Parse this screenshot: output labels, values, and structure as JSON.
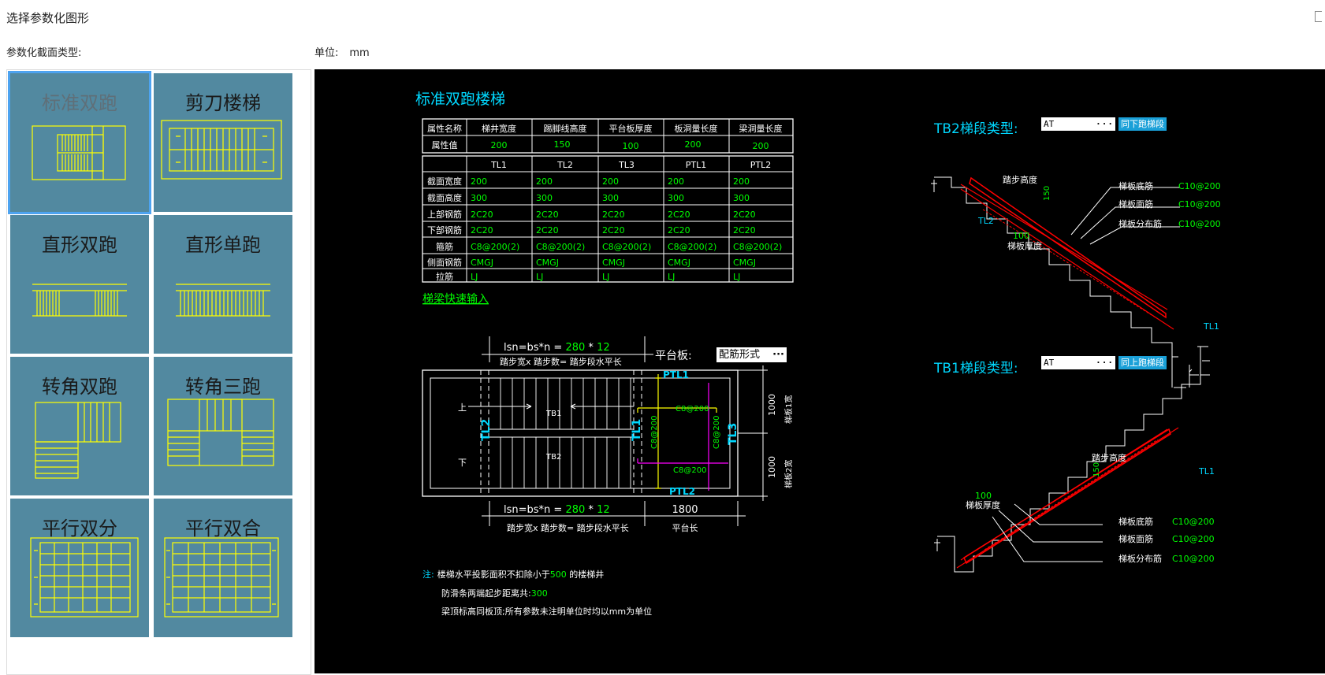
{
  "window": {
    "title": "选择参数化图形"
  },
  "left": {
    "section_label": "参数化截面类型:",
    "thumbnails": [
      {
        "label": "标准双跑"
      },
      {
        "label": "剪刀楼梯"
      },
      {
        "label": "直形双跑"
      },
      {
        "label": "直形单跑"
      },
      {
        "label": "转角双跑"
      },
      {
        "label": "转角三跑"
      },
      {
        "label": "平行双分"
      },
      {
        "label": "平行双合"
      }
    ]
  },
  "unit": {
    "label": "单位:",
    "value": "mm"
  },
  "drawing": {
    "title": "标准双跑楼梯",
    "prop_table": {
      "headers": [
        "属性名称",
        "梯井宽度",
        "踢脚线高度",
        "平台板厚度",
        "板洞量长度",
        "梁洞量长度"
      ],
      "row_label": "属性值",
      "values": [
        "200",
        "150",
        "100",
        "200",
        "200"
      ]
    },
    "beam_table": {
      "headers": [
        "",
        "TL1",
        "TL2",
        "TL3",
        "PTL1",
        "PTL2"
      ],
      "rows": [
        {
          "label": "截面宽度",
          "cells": [
            "200",
            "200",
            "200",
            "200",
            "200"
          ]
        },
        {
          "label": "截面高度",
          "cells": [
            "300",
            "300",
            "300",
            "300",
            "300"
          ]
        },
        {
          "label": "上部钢筋",
          "cells": [
            "2C20",
            "2C20",
            "2C20",
            "2C20",
            "2C20"
          ]
        },
        {
          "label": "下部钢筋",
          "cells": [
            "2C20",
            "2C20",
            "2C20",
            "2C20",
            "2C20"
          ]
        },
        {
          "label": "箍筋",
          "cells": [
            "C8@200(2)",
            "C8@200(2)",
            "C8@200(2)",
            "C8@200(2)",
            "C8@200(2)"
          ]
        },
        {
          "label": "侧面钢筋",
          "cells": [
            "CMGJ",
            "CMGJ",
            "CMGJ",
            "CMGJ",
            "CMGJ"
          ]
        },
        {
          "label": "拉筋",
          "cells": [
            "LJ",
            "LJ",
            "LJ",
            "LJ",
            "LJ"
          ]
        }
      ]
    },
    "quick_input_link": "梯梁快速输入",
    "plan": {
      "formula_top_prefix": "lsn=bs*n = ",
      "bs": "280",
      "times": "*",
      "n": "12",
      "formula_note": "踏步宽x 踏步数= 踏步段水平长",
      "platform_label": "平台板:",
      "platform_value": "配筋形式",
      "platform_len": "1800",
      "platform_len_label": "平台长",
      "up": "上",
      "down": "下",
      "tb1": "TB1",
      "tb2": "TB2",
      "tl1": "TL1",
      "tl2": "TL2",
      "tl3": "TL3",
      "ptl1": "PTL1",
      "ptl2": "PTL2",
      "rebar_a": "C8@200",
      "rebar_b": "C8@200",
      "rebar_c": "C8@200",
      "rebar_d": "C8@200",
      "width1": "1000",
      "width2": "1000",
      "width1_label": "梯板1宽",
      "width2_label": "梯板2宽"
    },
    "notes": {
      "prefix": "注:",
      "line1_a": "楼梯水平投影面积不扣除小于",
      "line1_value": "500",
      "line1_b": " 的楼梯井",
      "line2_a": "防滑条两端起步距离共:",
      "line2_value": "300",
      "line3": "梁顶标高同板顶;所有参数未注明单位时均以mm为单位"
    },
    "tb2": {
      "label": "TB2梯段类型:",
      "value": "AT",
      "button": "同下跑梯段",
      "step_height_label": "踏步高度",
      "step_height": "150",
      "thickness_value": "100",
      "thickness_label": "梯板厚度",
      "bottom_bar_label": "梯板底筋",
      "bottom_bar": "C10@200",
      "top_bar_label": "梯板面筋",
      "top_bar": "C10@200",
      "dist_bar_label": "梯板分布筋",
      "dist_bar": "C10@200",
      "tl2": "TL2",
      "tl1": "TL1"
    },
    "tb1": {
      "label": "TB1梯段类型:",
      "value": "AT",
      "button": "同上跑梯段",
      "step_height_label": "踏步高度",
      "step_height": "150",
      "thickness_value": "100",
      "thickness_label": "梯板厚度",
      "bottom_bar_label": "梯板底筋",
      "bottom_bar": "C10@200",
      "top_bar_label": "梯板面筋",
      "top_bar": "C10@200",
      "dist_bar_label": "梯板分布筋",
      "dist_bar": "C10@200",
      "tl1": "TL1"
    }
  },
  "colors": {
    "accent": "#4da3f0",
    "thumb_bg": "#5289a0",
    "cad_bg": "#000000",
    "cad_yellow": "#ffff00",
    "cad_green": "#00ff00",
    "cad_cyan": "#00d8ff",
    "cad_red": "#ff0000",
    "cad_magenta": "#ff00ff"
  }
}
